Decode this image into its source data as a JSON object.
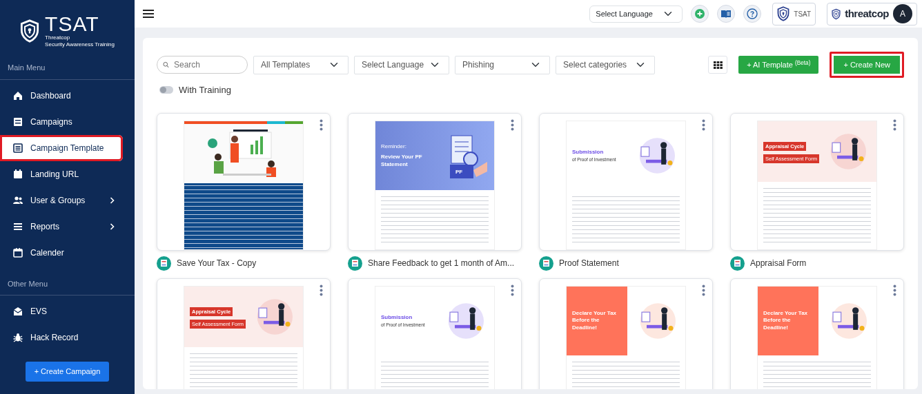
{
  "sidebar": {
    "logo": {
      "name": "TSAT",
      "line1": "Threatcop",
      "line2": "Security Awareness Training"
    },
    "sections": [
      {
        "heading": "Main Menu",
        "items": [
          {
            "label": "Dashboard",
            "selected": false,
            "has_submenu": false,
            "annotated": false
          },
          {
            "label": "Campaigns",
            "selected": false,
            "has_submenu": false,
            "annotated": false
          },
          {
            "label": "Campaign Template",
            "selected": true,
            "has_submenu": false,
            "annotated": true
          },
          {
            "label": "Landing URL",
            "selected": false,
            "has_submenu": false,
            "annotated": false
          },
          {
            "label": "User & Groups",
            "selected": false,
            "has_submenu": true,
            "annotated": false
          },
          {
            "label": "Reports",
            "selected": false,
            "has_submenu": true,
            "annotated": false
          },
          {
            "label": "Calender",
            "selected": false,
            "has_submenu": false,
            "annotated": false
          }
        ]
      },
      {
        "heading": "Other Menu",
        "items": [
          {
            "label": "EVS",
            "selected": false,
            "has_submenu": false,
            "annotated": false
          },
          {
            "label": "Hack Record",
            "selected": false,
            "has_submenu": false,
            "annotated": false
          }
        ]
      }
    ],
    "create_button": "+ Create Campaign"
  },
  "header": {
    "language_select": "Select Language",
    "product": {
      "label": "TSAT"
    },
    "brand": "threatcop",
    "avatar": "A"
  },
  "toolbar": {
    "search": {
      "placeholder": "Search"
    },
    "filters": [
      "All Templates",
      "Select Language",
      "Phishing",
      "Select categories"
    ],
    "ai_button": {
      "label": "+  AI Template $^{(Beta)}$"
    },
    "create_button": {
      "label": "+  Create New",
      "annotated": true
    },
    "training_toggle": {
      "label": "With Training",
      "on": false
    }
  },
  "cards": [
    {
      "title": "Save Your Tax - Copy",
      "preview": {
        "kind": "tax"
      }
    },
    {
      "title": "Share Feedback to get 1 month of Am...",
      "preview": {
        "kind": "banner",
        "kicker": "Reminder:",
        "heading": "Review Your PF Statement",
        "badge": "PF"
      }
    },
    {
      "title": "Proof Statement",
      "preview": {
        "kind": "split",
        "heading": "Submission",
        "subheading": "of Proof of Investment"
      }
    },
    {
      "title": "Appraisal Form",
      "preview": {
        "kind": "appraisal",
        "heading": "Appraisal Cycle",
        "subheading": "Self Assessment Form"
      }
    },
    {
      "preview": {
        "kind": "appraisal",
        "heading": "Appraisal Cycle",
        "subheading": "Self Assessment Form"
      }
    },
    {
      "preview": {
        "kind": "split",
        "heading": "Submission",
        "subheading": "of Proof of Investment"
      }
    },
    {
      "preview": {
        "kind": "declare",
        "heading": "Declare Your Tax Before the Deadline!"
      }
    },
    {
      "preview": {
        "kind": "declare",
        "heading": "Declare Your Tax Before the Deadline!"
      }
    }
  ]
}
